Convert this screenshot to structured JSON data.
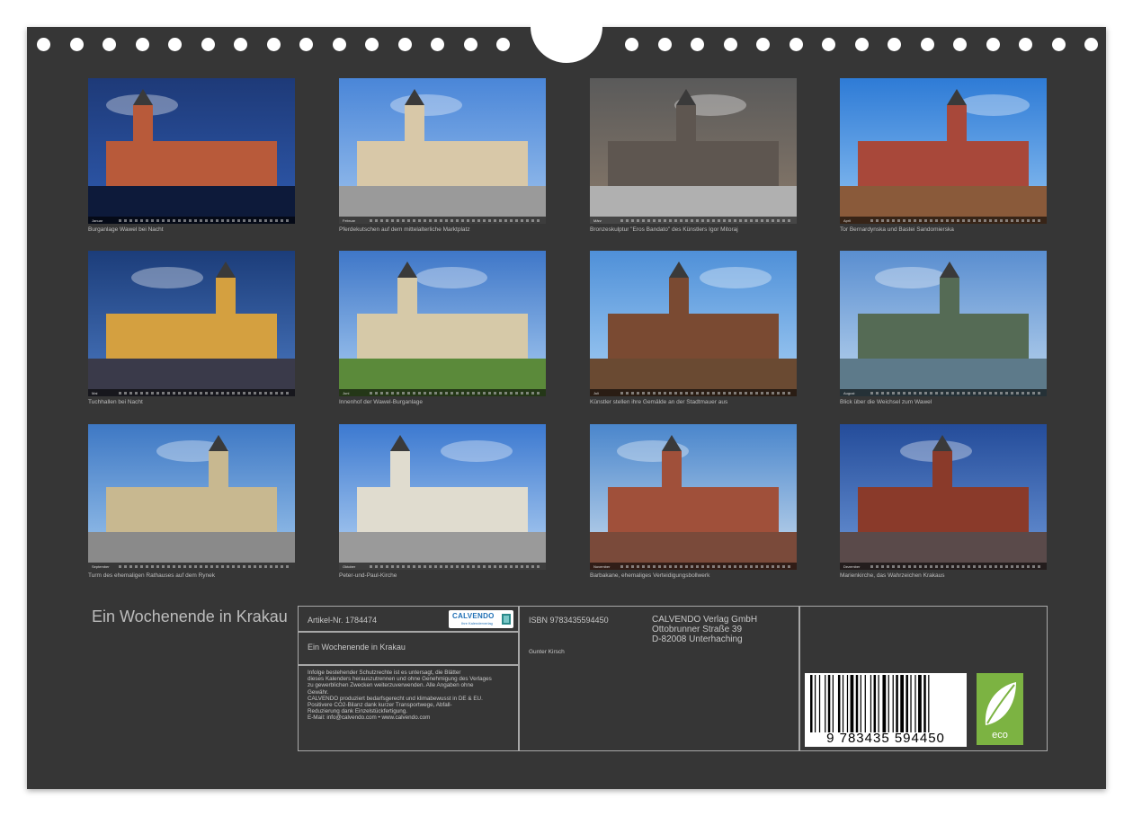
{
  "calendar": {
    "title": "Ein Wochenende in Krakau",
    "months": [
      {
        "strip": "Januar",
        "caption": "Burganlage Wawel bei Nacht"
      },
      {
        "strip": "Februar",
        "caption": "Pferdekutschen auf dem mittelalterliche Marktplatz"
      },
      {
        "strip": "März",
        "caption": "Bronzeskulptur \"Eros Bandato\" des Künstlers Igor Mitoraj"
      },
      {
        "strip": "April",
        "caption": "Tor Bernardynska und Bastei Sandomierska"
      },
      {
        "strip": "Mai",
        "caption": "Tuchhallen bei Nacht"
      },
      {
        "strip": "Juni",
        "caption": "Innenhof der Wawel-Burganlage"
      },
      {
        "strip": "Juli",
        "caption": "Künstler stellen ihre Gemälde an der Stadtmauer aus"
      },
      {
        "strip": "August",
        "caption": "Blick über die Weichsel zum Wawel"
      },
      {
        "strip": "September",
        "caption": "Turm des ehemaligen Rathauses auf dem Rynek"
      },
      {
        "strip": "Oktober",
        "caption": "Peter-und-Paul-Kirche"
      },
      {
        "strip": "November",
        "caption": "Barbakane, ehemaliges Verteidigungsbollwerk"
      },
      {
        "strip": "Dezember",
        "caption": "Marienkirche, das Wahrzeichen Krakaus"
      }
    ]
  },
  "info": {
    "article": "Artikel-Nr. 1784474",
    "logo": "CALVENDO",
    "logo_sub": "Ihre Kalenderverlag",
    "book_title": "Ein Wochenende in Krakau",
    "legal": [
      "Infolge bestehender Schutzrechte ist es untersagt, die Blätter",
      "dieses Kalenders herauszutrennen und ohne Genehmigung des Verlages",
      "zu gewerblichen Zwecken weiterzuverwenden. Alle Angaben ohne",
      "Gewähr.",
      "CALVENDO produziert bedarfsgerecht und klimabewusst in DE & EU.",
      "Positivere CO2-Bilanz dank kurzer Transportwege, Abfall-",
      "Reduzierung dank Einzelstückfertigung.",
      "E-Mail: info@calvendo.com • www.calvendo.com"
    ],
    "isbn": "ISBN 9783435594450",
    "author": "Gunter Kirsch",
    "publisher": [
      "CALVENDO Verlag GmbH",
      "Ottobrunner Straße 39",
      "D-82008 Unterhaching"
    ],
    "barcode_number": "9 783435 594450",
    "eco_label": "eco"
  },
  "colors": {
    "sheet": "#363636",
    "caption": "#bdbdbd",
    "border": "#a8a8a8",
    "eco_green": "#7cb342"
  }
}
